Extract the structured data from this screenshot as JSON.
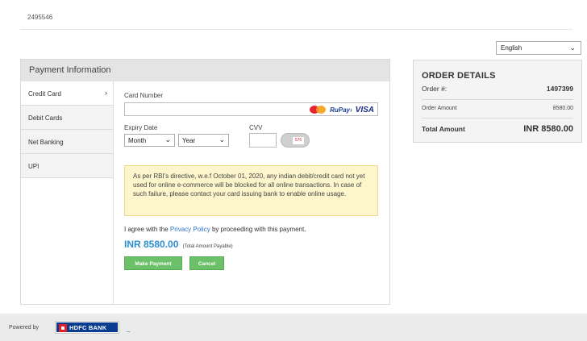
{
  "page_id": "2495546",
  "language": {
    "selected": "English"
  },
  "payment_panel": {
    "title": "Payment Information",
    "tabs": [
      {
        "label": "Credit Card",
        "active": true,
        "arrow": "›"
      },
      {
        "label": "Debit Cards"
      },
      {
        "label": "Net Banking"
      },
      {
        "label": "UPI"
      }
    ]
  },
  "form": {
    "card_number_label": "Card Number",
    "card_number_value": "",
    "expiry_label": "Expiry Date",
    "month_value": "Month",
    "year_value": "Year",
    "cvv_label": "CVV",
    "cvv_value": "",
    "cvv_hint": "576",
    "brand_rupay": "RuPay›",
    "brand_visa": "VISA",
    "notice": "As per RBI's directive, w.e.f October 01, 2020, any indian debit/credit card not yet used for online e-commerce will be blocked for all online transactions. In case of such failure, please contact your card issuing bank to enable online usage.",
    "agree_prefix": "I agree with the ",
    "agree_link": "Privacy Policy",
    "agree_suffix": " by proceeding with this payment.",
    "amount": "INR 8580.00",
    "amount_note": "(Total Amount Payable)",
    "make_payment_label": "Make Payment",
    "cancel_label": "Cancel"
  },
  "order": {
    "title": "ORDER DETAILS",
    "order_no_label": "Order #:",
    "order_no": "1497399",
    "order_amount_label": "Order Amount",
    "order_amount": "8580.00",
    "total_label": "Total Amount",
    "total": "INR 8580.00"
  },
  "footer": {
    "powered_by": "Powered by",
    "bank_logo_text": "HDFC BANK",
    "dash": "_"
  },
  "colors": {
    "button_green": "#6cc06a",
    "amount_blue": "#2d8fd0",
    "link_blue": "#2d73c5",
    "notice_bg": "#fdf6cc",
    "hdfc_blue": "#073c8f",
    "hdfc_red": "#e21f26"
  }
}
